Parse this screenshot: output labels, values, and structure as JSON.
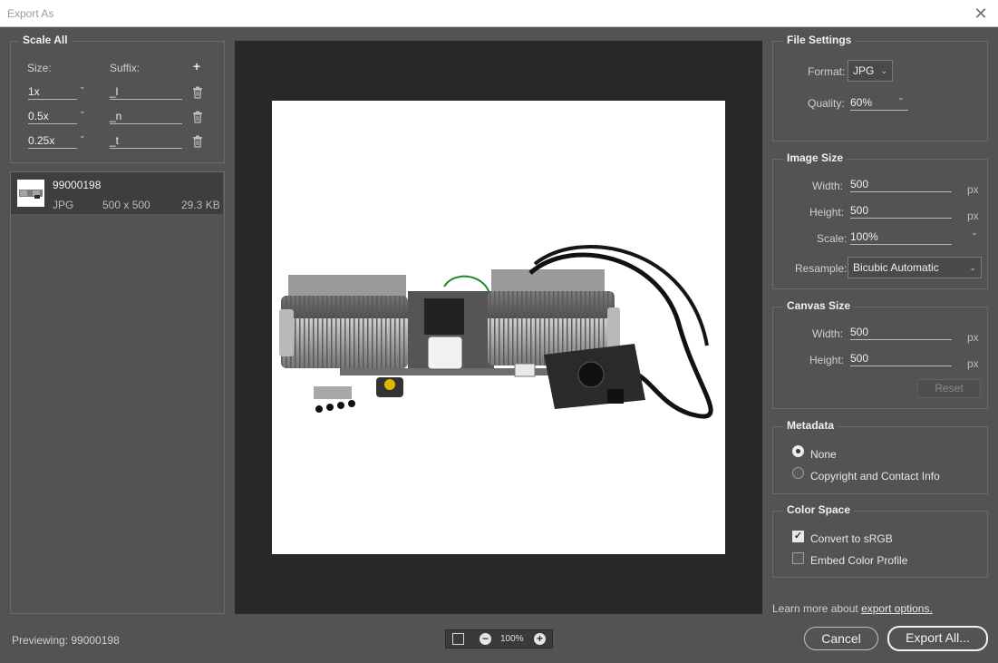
{
  "window": {
    "title": "Export As",
    "close_glyph": "✕"
  },
  "scale_all": {
    "title": "Scale All",
    "size_label": "Size:",
    "suffix_label": "Suffix:",
    "add_glyph": "+",
    "rows": [
      {
        "size": "1x",
        "suffix": "_l"
      },
      {
        "size": "0.5x",
        "suffix": "_n"
      },
      {
        "size": "0.25x",
        "suffix": "_t"
      }
    ]
  },
  "asset": {
    "name": "99000198",
    "format": "JPG",
    "dimensions": "500 x 500",
    "file_size": "29.3 KB"
  },
  "file_settings": {
    "title": "File Settings",
    "format_label": "Format:",
    "format_value": "JPG",
    "quality_label": "Quality:",
    "quality_value": "60%"
  },
  "image_size": {
    "title": "Image Size",
    "width_label": "Width:",
    "width_value": "500",
    "height_label": "Height:",
    "height_value": "500",
    "scale_label": "Scale:",
    "scale_value": "100%",
    "resample_label": "Resample:",
    "resample_value": "Bicubic Automatic",
    "unit": "px"
  },
  "canvas_size": {
    "title": "Canvas Size",
    "width_label": "Width:",
    "width_value": "500",
    "height_label": "Height:",
    "height_value": "500",
    "unit": "px",
    "reset_label": "Reset"
  },
  "metadata": {
    "title": "Metadata",
    "options": [
      {
        "label": "None",
        "selected": true
      },
      {
        "label": "Copyright and Contact Info",
        "selected": false
      }
    ]
  },
  "color_space": {
    "title": "Color Space",
    "options": [
      {
        "label": "Convert to sRGB",
        "checked": true
      },
      {
        "label": "Embed Color Profile",
        "checked": false
      }
    ]
  },
  "footer": {
    "learn_more_prefix": "Learn more about",
    "learn_more_link": "export options.",
    "previewing": "Previewing: 99000198",
    "zoom_level": "100%",
    "zoom_out_glyph": "−",
    "zoom_in_glyph": "+",
    "cancel_label": "Cancel",
    "export_label": "Export All..."
  },
  "colors": {
    "dialog_bg": "#535353",
    "preview_bg": "#282828",
    "selected_row": "#3e3e3e"
  }
}
